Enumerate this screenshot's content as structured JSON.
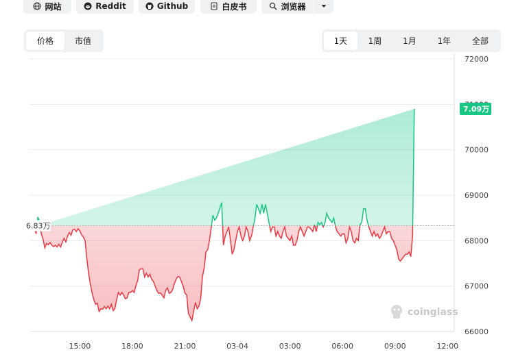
{
  "top_links": [
    {
      "label": "网站",
      "icon": "globe-icon"
    },
    {
      "label": "Reddit",
      "icon": "reddit-icon"
    },
    {
      "label": "Github",
      "icon": "github-icon"
    },
    {
      "label": "白皮书",
      "icon": "document-icon"
    },
    {
      "label": "浏览器",
      "icon": "search-icon"
    }
  ],
  "metric_tabs": [
    {
      "label": "价格",
      "active": true
    },
    {
      "label": "市值",
      "active": false
    }
  ],
  "range_tabs": [
    {
      "label": "1天",
      "active": true
    },
    {
      "label": "1周",
      "active": false
    },
    {
      "label": "1月",
      "active": false
    },
    {
      "label": "1年",
      "active": false
    },
    {
      "label": "全部",
      "active": false
    }
  ],
  "watermark": "coinglass",
  "colors": {
    "up": "#16c784",
    "down": "#ea3943"
  },
  "chart_data": {
    "type": "area",
    "x_ticks": [
      "15:00",
      "18:00",
      "21:00",
      "03-04",
      "03:00",
      "06:00",
      "09:00",
      "12:00"
    ],
    "y_ticks": [
      "72000",
      "71000",
      "70000",
      "69000",
      "68000",
      "67000",
      "66000"
    ],
    "ylim": [
      66000,
      72000
    ],
    "baseline": 68330,
    "baseline_label": "6.83万",
    "current_value": 70900,
    "current_label": "7.09万",
    "grid": true,
    "x_hours": [
      0.0,
      0.1,
      0.2,
      0.3,
      0.4,
      0.5,
      0.6,
      0.7,
      0.8,
      0.9,
      1.0,
      1.1,
      1.2,
      1.3,
      1.4,
      1.5,
      1.6,
      1.7,
      1.8,
      1.9,
      2.0,
      2.1,
      2.2,
      2.3,
      2.4,
      2.5,
      2.6,
      2.7,
      2.8,
      2.9,
      3.0,
      3.1,
      3.2,
      3.3,
      3.4,
      3.5,
      3.6,
      3.7,
      3.8,
      3.9,
      4.0,
      4.1,
      4.2,
      4.3,
      4.4,
      4.5,
      4.6,
      4.7,
      4.8,
      4.9,
      5.0,
      5.1,
      5.2,
      5.3,
      5.4,
      5.5,
      5.6,
      5.7,
      5.8,
      5.9,
      6.0,
      6.1,
      6.2,
      6.3,
      6.4,
      6.5,
      6.6,
      6.7,
      6.8,
      6.9,
      7.0,
      7.1,
      7.2,
      7.3,
      7.4,
      7.5,
      7.6,
      7.7,
      7.8,
      7.9,
      8.0,
      8.1,
      8.2,
      8.3,
      8.4,
      8.5,
      8.6,
      8.7,
      8.8,
      8.9,
      9.0,
      9.1,
      9.2,
      9.3,
      9.4,
      9.5,
      9.6,
      9.7,
      9.8,
      9.9,
      10.0,
      10.1,
      10.2,
      10.3,
      10.4,
      10.5,
      10.6,
      10.7,
      10.8,
      10.9,
      11.0,
      11.1,
      11.2,
      11.3,
      11.4,
      11.5,
      11.6,
      11.7,
      11.8,
      11.9,
      12.0,
      12.1,
      12.2,
      12.3,
      12.4,
      12.5,
      12.6,
      12.7,
      12.8,
      12.9,
      13.0,
      13.1,
      13.2,
      13.3,
      13.4,
      13.5,
      13.6,
      13.7,
      13.8,
      13.9,
      14.0,
      14.1,
      14.2,
      14.3,
      14.4,
      14.5,
      14.6,
      14.7,
      14.8,
      14.9,
      15.0,
      15.1,
      15.2,
      15.3,
      15.4,
      15.5,
      15.6,
      15.7,
      15.8,
      15.9,
      16.0,
      16.1,
      16.2,
      16.3,
      16.4,
      16.5,
      16.6,
      16.7,
      16.8,
      16.9,
      17.0,
      17.1,
      17.2,
      17.3,
      17.4,
      17.5,
      17.6,
      17.7,
      17.8,
      17.9,
      18.0,
      18.1,
      18.2,
      18.3,
      18.4,
      18.5,
      18.6,
      18.7,
      18.8,
      18.9,
      19.0,
      19.1,
      19.2,
      19.3,
      19.4,
      19.5,
      19.6,
      19.7,
      19.8,
      19.9,
      20.0,
      20.1,
      20.2,
      20.3,
      20.4,
      20.5,
      20.6,
      20.7,
      20.8,
      20.9,
      21.0,
      21.1,
      21.2,
      21.3,
      21.4,
      21.5,
      21.6,
      21.7,
      21.8,
      21.9,
      22.0,
      22.1,
      22.2,
      22.3,
      22.4,
      22.5,
      22.6,
      22.7,
      22.8,
      22.9,
      23.0,
      23.1,
      23.2,
      23.3,
      23.4,
      23.5,
      23.6,
      23.7,
      23.8,
      23.9
    ],
    "values": [
      68300,
      68150,
      68520,
      68420,
      68150,
      68030,
      67840,
      67940,
      67910,
      67960,
      67900,
      67870,
      67900,
      67860,
      67920,
      67860,
      67960,
      68050,
      67970,
      68100,
      68180,
      68120,
      68240,
      68250,
      68200,
      68260,
      68210,
      68130,
      68080,
      68000,
      67600,
      67280,
      67040,
      66850,
      66700,
      66600,
      66620,
      66440,
      66500,
      66490,
      66550,
      66500,
      66560,
      66500,
      66600,
      66460,
      66500,
      66700,
      66860,
      66800,
      66860,
      66800,
      66720,
      66740,
      66860,
      66860,
      66900,
      66860,
      67000,
      67120,
      67360,
      67380,
      67380,
      67200,
      67280,
      67200,
      67260,
      67150,
      67100,
      67000,
      66900,
      66840,
      66850,
      66800,
      66740,
      66900,
      66960,
      66840,
      66860,
      66920,
      67060,
      67150,
      67210,
      67200,
      67100,
      67000,
      66850,
      66800,
      66400,
      66320,
      66240,
      66450,
      66640,
      66500,
      66560,
      66720,
      67200,
      67400,
      67750,
      67800,
      68000,
      68280,
      68560,
      68450,
      68500,
      68600,
      68720,
      68840,
      67900,
      68100,
      68200,
      68300,
      68000,
      67700,
      67800,
      68000,
      68200,
      68300,
      68100,
      68000,
      68100,
      68300,
      68200,
      68000,
      68100,
      68300,
      68500,
      68800,
      68700,
      68600,
      68800,
      68600,
      68800,
      68600,
      68400,
      68200,
      68300,
      68300,
      68100,
      68200,
      68100,
      68050,
      68200,
      68300,
      68100,
      68050,
      68000,
      68100,
      67900,
      67900,
      68000,
      68200,
      68300,
      68200,
      68100,
      68200,
      68300,
      68300,
      68250,
      68200,
      68350,
      68200,
      68400,
      68350,
      68400,
      68300,
      68400,
      68600,
      68500,
      68450,
      68400,
      68500,
      68300,
      68200,
      68150,
      68100,
      68150,
      68150,
      67950,
      68050,
      68300,
      68200,
      68000,
      67950,
      68050,
      68000,
      68350,
      68400,
      68700,
      68700,
      68450,
      68300,
      68200,
      68100,
      68200,
      68100,
      68150,
      68050,
      68100,
      68200,
      68300,
      68150,
      68200,
      68200,
      68050,
      68000,
      67900,
      67800,
      67600,
      67550,
      67600,
      67650,
      67700,
      67700,
      67750,
      67650,
      68100,
      70900
    ]
  }
}
